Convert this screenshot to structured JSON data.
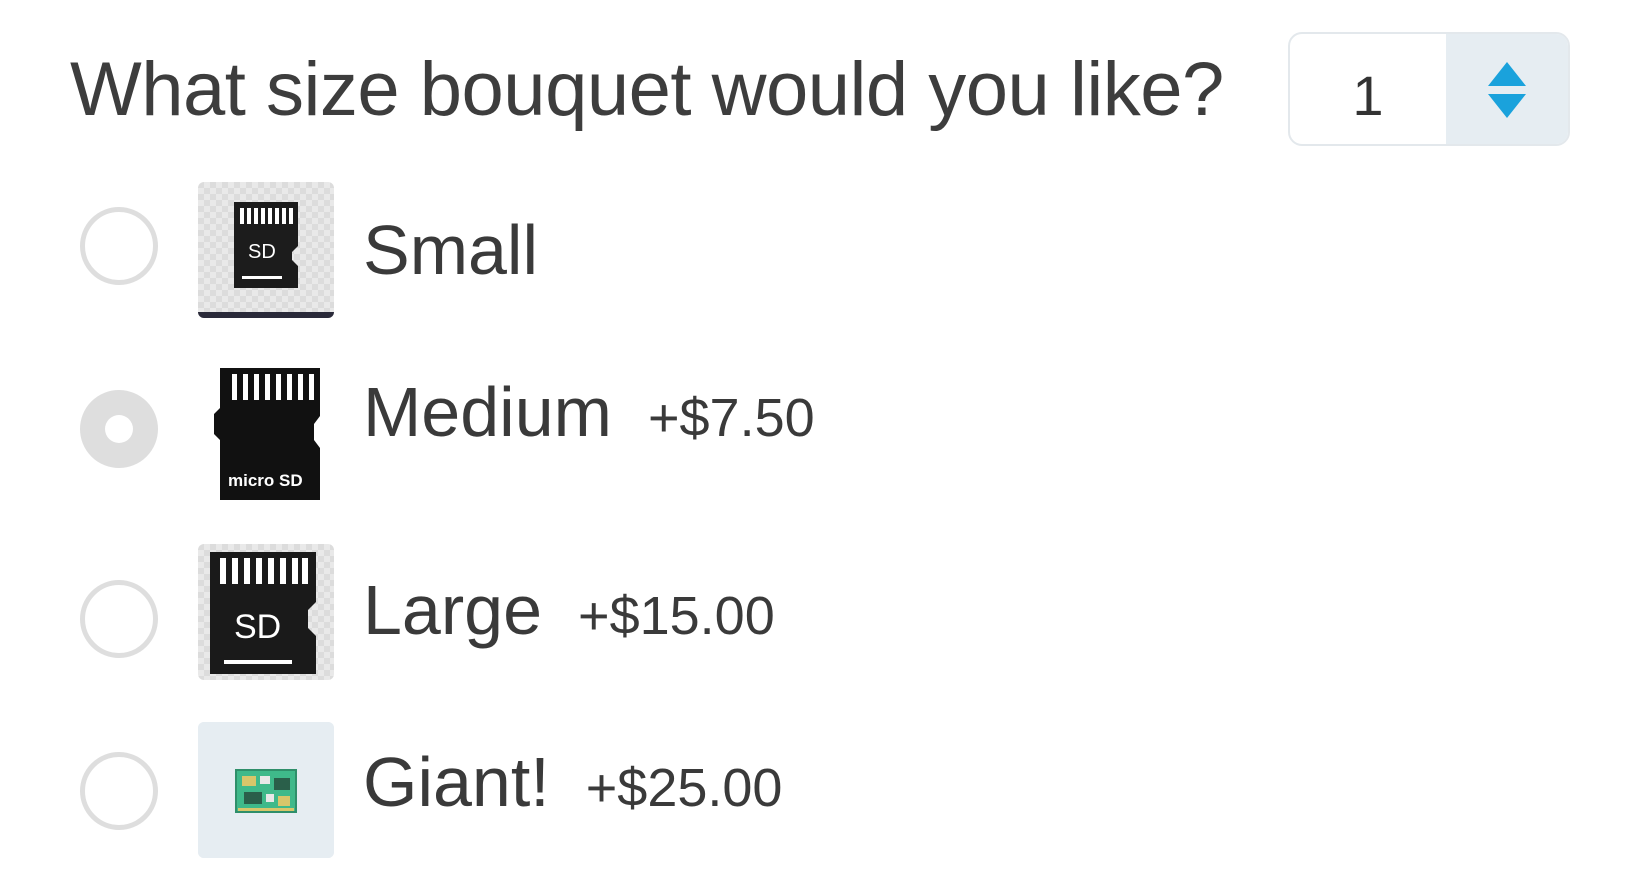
{
  "question": "What size bouquet would you like?",
  "quantity": {
    "value": "1"
  },
  "colors": {
    "accent": "#1aa2dc",
    "radio_border": "#dedede",
    "stepper_bg": "#e6edf2"
  },
  "options": [
    {
      "label": "Small",
      "price": "",
      "selected": false,
      "icon": "sd-card-icon"
    },
    {
      "label": "Medium",
      "price": "+$7.50",
      "selected": true,
      "icon": "microsd-card-icon"
    },
    {
      "label": "Large",
      "price": "+$15.00",
      "selected": false,
      "icon": "sd-card-icon"
    },
    {
      "label": "Giant!",
      "price": "+$25.00",
      "selected": false,
      "icon": "circuit-board-icon"
    }
  ],
  "thumb_text": {
    "small": "SD",
    "medium": "micro SD",
    "large": "SD"
  }
}
